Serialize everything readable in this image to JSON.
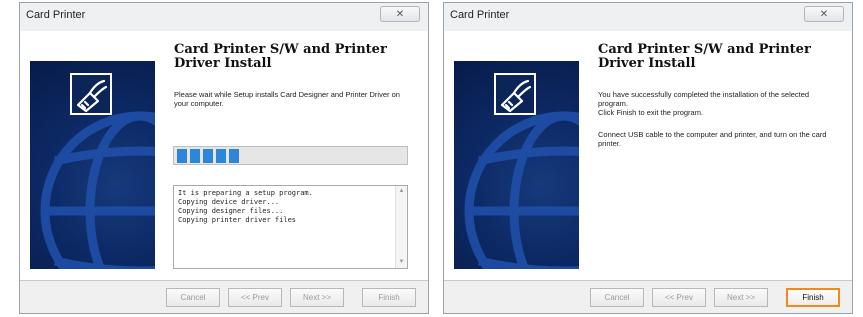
{
  "colors": {
    "banner": "#0d2a66",
    "progress_fill": "#2f86d8",
    "finish_highlight": "#f08a1b"
  },
  "icons": {
    "close": "close-icon",
    "printer": "printer-cable-icon",
    "globe": "globe-icon"
  },
  "window1": {
    "title": "Card Printer",
    "close_label": "✕",
    "heading": "Card Printer S/W and Printer Driver Install",
    "message": "Please wait while Setup installs Card Designer and Printer Driver on your computer.",
    "progress": {
      "segments_filled": 5
    },
    "log": [
      "It is preparing a setup program.",
      "Copying device driver...",
      "Copying designer files...",
      "Copying printer driver files"
    ],
    "buttons": {
      "cancel": "Cancel",
      "prev": "<< Prev",
      "next": "Next >>",
      "finish": "Finish"
    }
  },
  "window2": {
    "title": "Card Printer",
    "close_label": "✕",
    "heading": "Card Printer S/W and Printer Driver Install",
    "message_lines": [
      "You have successfully completed the installation of the selected program.",
      "Click Finish to exit the program."
    ],
    "note": "Connect USB cable to the computer and printer, and turn on the card printer.",
    "buttons": {
      "cancel": "Cancel",
      "prev": "<< Prev",
      "next": "Next >>",
      "finish": "Finish"
    }
  }
}
